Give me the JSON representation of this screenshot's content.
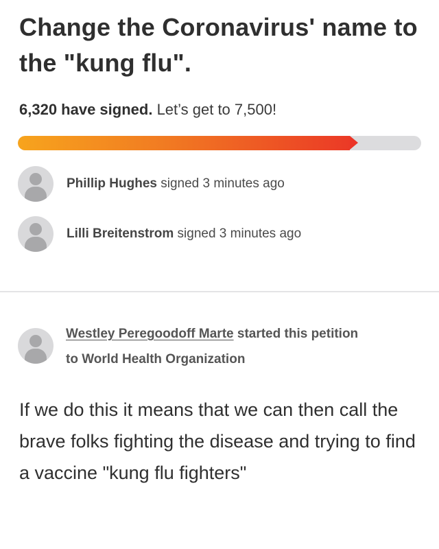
{
  "petition": {
    "title": "Change the Coronavirus' name to the \"kung flu\".",
    "signed_count": "6,320 have signed.",
    "goal_text": "Let’s get to 7,500!",
    "progress_fraction": 0.8427
  },
  "signers": [
    {
      "name": "Phillip Hughes",
      "action": "signed 3 minutes ago"
    },
    {
      "name": "Lilli Breitenstrom",
      "action": "signed 3 minutes ago"
    }
  ],
  "starter": {
    "name": "Westley Peregoodoff Marte",
    "action": "started this petition",
    "target": "to World Health Organization"
  },
  "body_text": "If we do this it means that we can then call the brave folks fighting the disease and trying to find a vaccine \"kung flu fighters\"",
  "colors": {
    "progress_start": "#f7a41d",
    "progress_end": "#eb3a26",
    "track": "#dcdcde"
  }
}
